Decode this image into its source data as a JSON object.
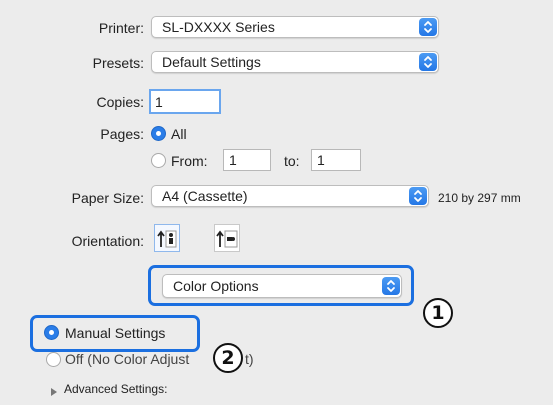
{
  "printer": {
    "label": "Printer:",
    "value": "SL-DXXXX Series"
  },
  "presets": {
    "label": "Presets:",
    "value": "Default Settings"
  },
  "copies": {
    "label": "Copies:",
    "value": "1"
  },
  "pages": {
    "label": "Pages:",
    "all_label": "All",
    "from_label": "From:",
    "from_value": "1",
    "to_label": "to:",
    "to_value": "1"
  },
  "paper_size": {
    "label": "Paper Size:",
    "value": "A4 (Cassette)",
    "dimensions": "210 by 297 mm"
  },
  "orientation": {
    "label": "Orientation:"
  },
  "section_popup": {
    "value": "Color Options"
  },
  "color_mode": {
    "manual": "Manual Settings",
    "off": "Off (No Color Adjust",
    "off_tail": "t)"
  },
  "advanced": {
    "label": "Advanced Settings:"
  },
  "callouts": {
    "one": "1",
    "two": "2"
  },
  "colors": {
    "accent": "#2a7de8",
    "callout": "#1b6fe0"
  }
}
